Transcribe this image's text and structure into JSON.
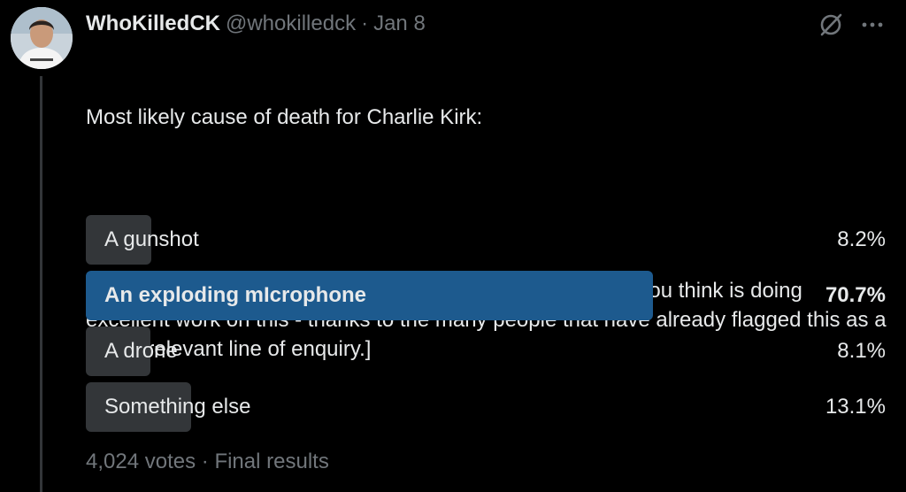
{
  "tweet": {
    "display_name": "WhoKilledCK",
    "handle": "@whokilledck",
    "separator": "·",
    "date": "Jan 8",
    "text_line1": "Most likely cause of death for Charlie Kirk:",
    "text_paragraph2": "[Tell us why you believe this in the replies, and tag anyone you think is doing excellent work on this - thanks to the many people that have already flagged this as a highly relevant line of enquiry.]"
  },
  "icons": {
    "grok": "grok-icon",
    "more": "more-icon",
    "avatar": "avatar"
  },
  "poll": {
    "options": [
      {
        "label": "A gunshot",
        "percent_text": "8.2%",
        "percent": 8.2,
        "winner": false
      },
      {
        "label": "An exploding mIcrophone",
        "percent_text": "70.7%",
        "percent": 70.7,
        "winner": true
      },
      {
        "label": "A drone",
        "percent_text": "8.1%",
        "percent": 8.1,
        "winner": false
      },
      {
        "label": "Something else",
        "percent_text": "13.1%",
        "percent": 13.1,
        "winner": false
      }
    ],
    "votes": "4,024 votes",
    "separator": "·",
    "status": "Final results"
  },
  "colors": {
    "background": "#000000",
    "text": "#e7e9ea",
    "muted": "#71767b",
    "bar": "#333639",
    "winner_bar": "#1d5a8e"
  }
}
